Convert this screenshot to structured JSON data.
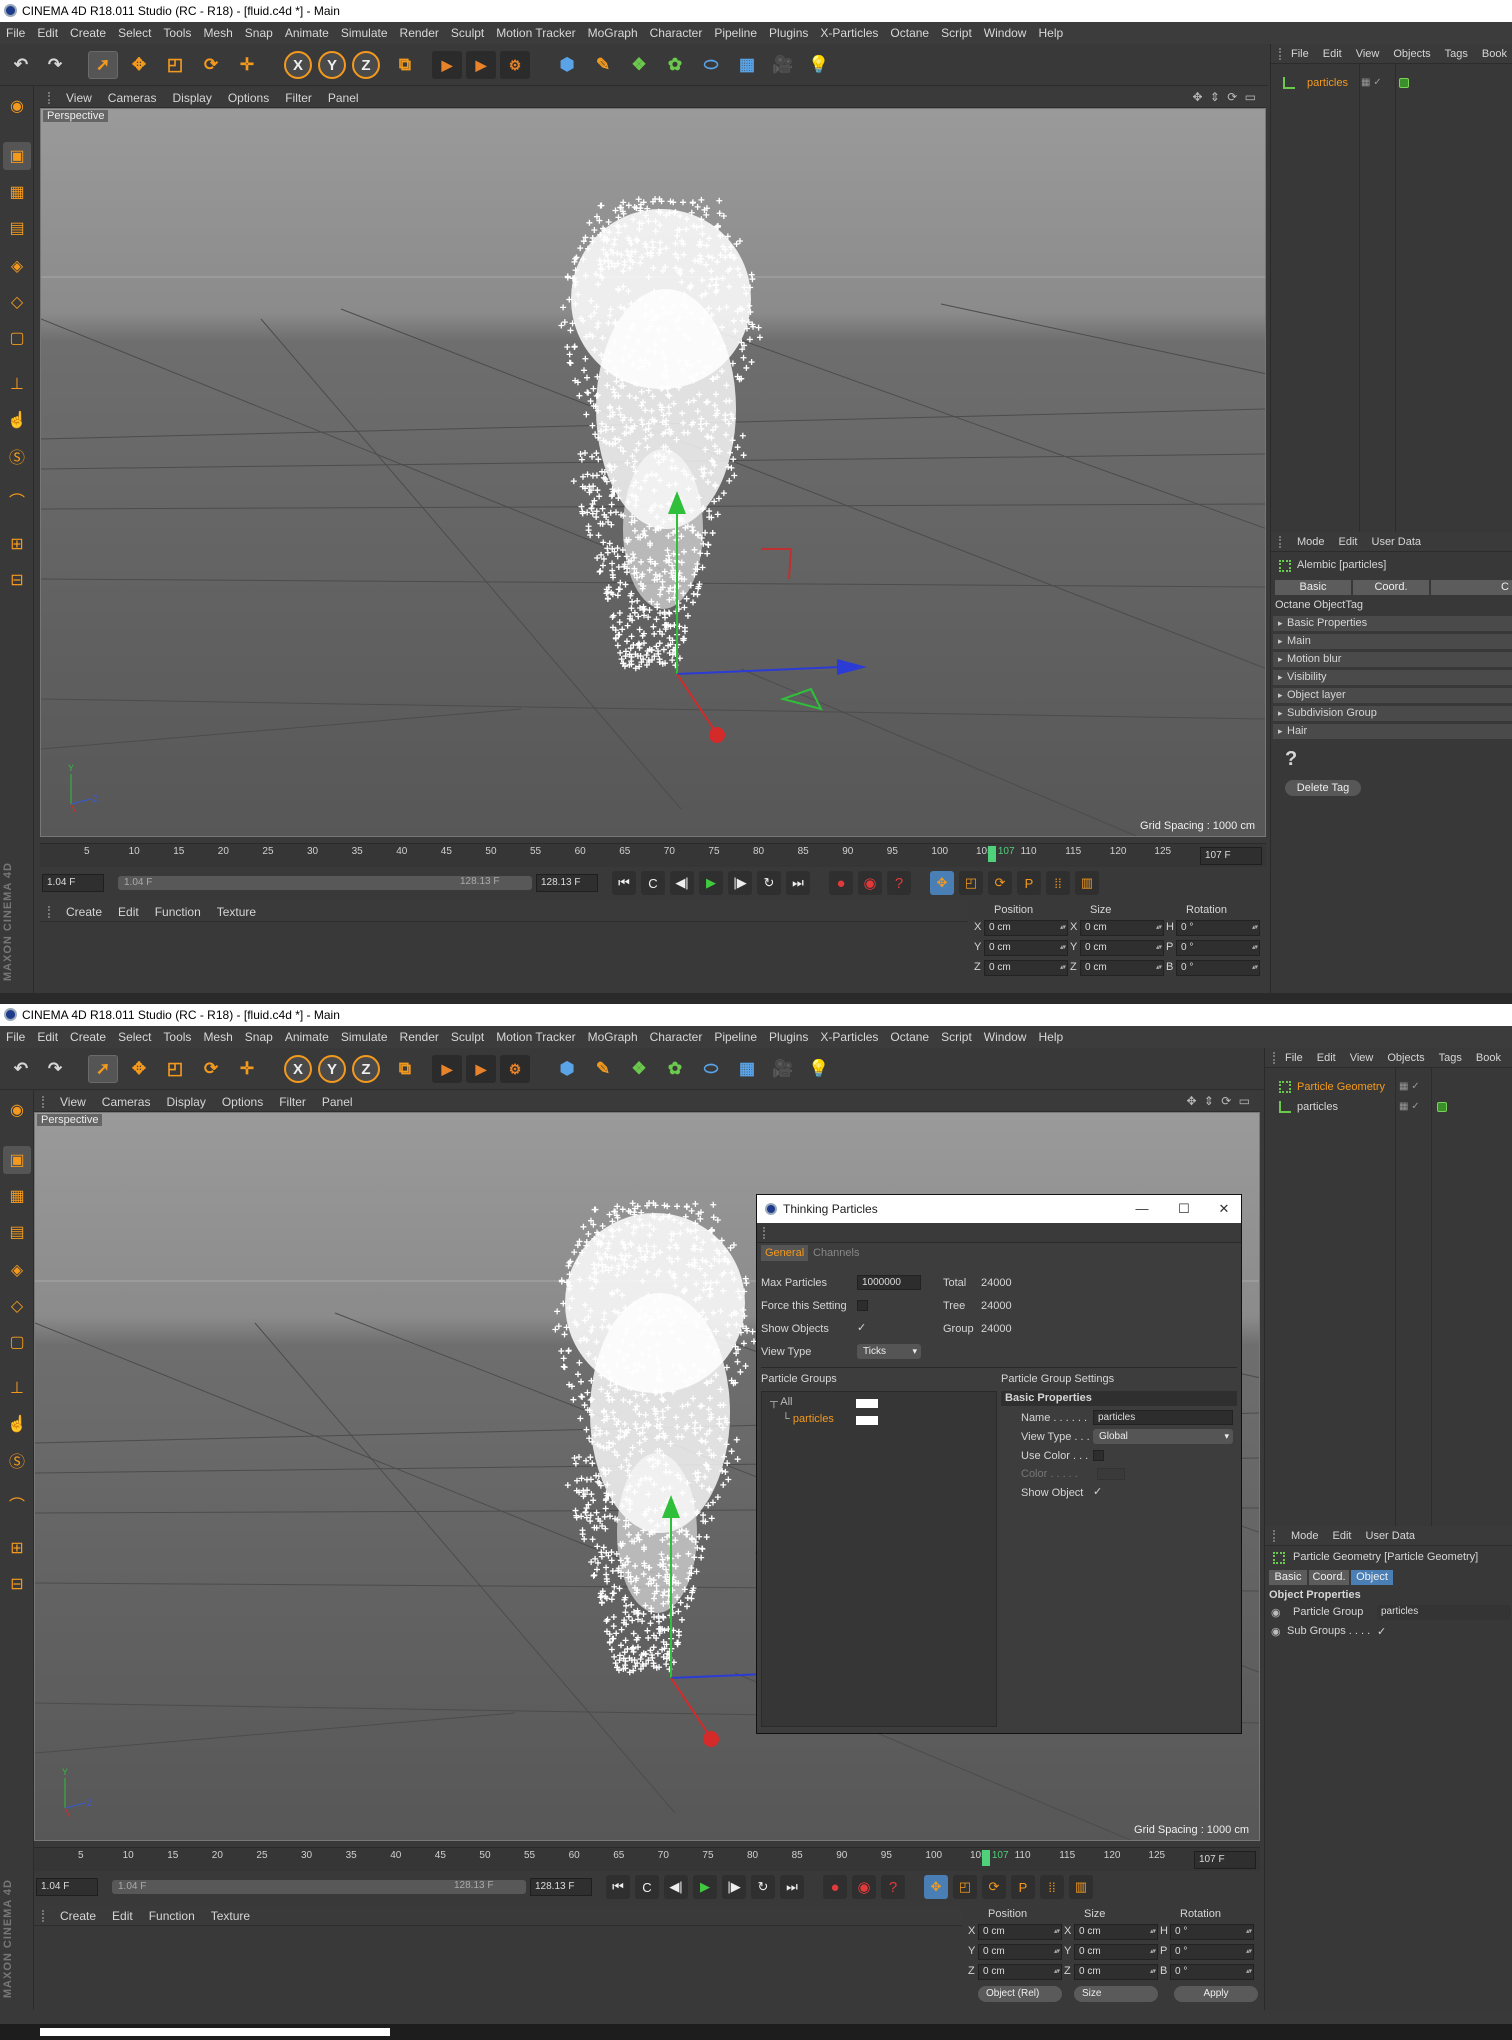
{
  "app": {
    "window_title": "CINEMA 4D R18.011 Studio (RC - R18) - [fluid.c4d *] - Main",
    "menu": [
      "File",
      "Edit",
      "Create",
      "Select",
      "Tools",
      "Mesh",
      "Snap",
      "Animate",
      "Simulate",
      "Render",
      "Sculpt",
      "Motion Tracker",
      "MoGraph",
      "Character",
      "Pipeline",
      "Plugins",
      "X-Particles",
      "Octane",
      "Script",
      "Window",
      "Help"
    ],
    "axis_buttons": [
      "X",
      "Y",
      "Z"
    ],
    "branding": "MAXON CINEMA 4D"
  },
  "icons": {
    "toolbar": [
      "undo-icon",
      "redo-icon",
      "select-arrow-icon",
      "move-icon",
      "scale-icon",
      "rotate-icon",
      "live-selection-icon",
      "x-axis-icon",
      "y-axis-icon",
      "z-axis-icon",
      "coordinate-system-icon",
      "render-view-icon",
      "render-picture-viewer-icon",
      "render-settings-icon",
      "cube-icon",
      "pen-icon",
      "subdivision-icon",
      "cloner-icon",
      "deformer-icon",
      "floor-icon",
      "camera-icon",
      "light-icon"
    ],
    "leftbar": [
      "make-editable-icon",
      "model-mode-icon",
      "texture-mode-icon",
      "workplane-icon",
      "points-mode-icon",
      "edges-mode-icon",
      "polygons-mode-icon",
      "axis-mode-icon",
      "tweak-mode-icon",
      "solo-icon",
      "snap-icon",
      "locked-workplane-icon",
      "planar-workplane-icon"
    ]
  },
  "viewport": {
    "menu": [
      "View",
      "Cameras",
      "Display",
      "Options",
      "Filter",
      "Panel"
    ],
    "label": "Perspective",
    "grid_spacing": "Grid Spacing : 1000 cm",
    "axis_labels": [
      "Y",
      "Z"
    ]
  },
  "timeline": {
    "ticks": [
      "5",
      "10",
      "15",
      "20",
      "25",
      "30",
      "35",
      "40",
      "45",
      "50",
      "55",
      "60",
      "65",
      "70",
      "75",
      "80",
      "85",
      "90",
      "95",
      "100",
      "105",
      "110",
      "115",
      "120",
      "125"
    ],
    "current_frame_marker": "107",
    "current_frame_field": "107 F",
    "start_field": "1.04 F",
    "range_start": "1.04 F",
    "range_end": "128.13 F",
    "end_field": "128.13 F"
  },
  "material_manager": {
    "menu": [
      "Create",
      "Edit",
      "Function",
      "Texture"
    ]
  },
  "coordinates": {
    "headers": [
      "Position",
      "Size",
      "Rotation"
    ],
    "rows": [
      {
        "axis": "X",
        "pos": "0 cm",
        "size_axis": "X",
        "size": "0 cm",
        "rot_axis": "H",
        "rot": "0 °"
      },
      {
        "axis": "Y",
        "pos": "0 cm",
        "size_axis": "Y",
        "size": "0 cm",
        "rot_axis": "P",
        "rot": "0 °"
      },
      {
        "axis": "Z",
        "pos": "0 cm",
        "size_axis": "Z",
        "size": "0 cm",
        "rot_axis": "B",
        "rot": "0 °"
      }
    ],
    "mode": "Object (Rel)",
    "size_mode": "Size",
    "apply": "Apply"
  },
  "object_manager": {
    "menu": [
      "File",
      "Edit",
      "View",
      "Objects",
      "Tags",
      "Book"
    ],
    "shot1_objects": [
      "particles"
    ],
    "shot2_objects": [
      "Particle Geometry",
      "particles"
    ]
  },
  "attributes": {
    "menu": [
      "Mode",
      "Edit",
      "User Data"
    ],
    "shot1": {
      "title": "Alembic [particles]",
      "tabs": [
        "Basic",
        "Coord.",
        "C"
      ],
      "section": "Octane ObjectTag",
      "groups": [
        "Basic Properties",
        "Main",
        "Motion blur",
        "Visibility",
        "Object layer",
        "Subdivision Group",
        "Hair"
      ],
      "help": "?",
      "delete_tag": "Delete Tag"
    },
    "shot2": {
      "title": "Particle Geometry [Particle Geometry]",
      "tabs": [
        "Basic",
        "Coord.",
        "Object"
      ],
      "section": "Object Properties",
      "particle_group_label": "Particle Group",
      "particle_group_value": "particles",
      "sub_groups_label": "Sub Groups . . . ."
    }
  },
  "thinking_particles": {
    "title": "Thinking Particles",
    "tabs": [
      "General",
      "Channels"
    ],
    "max_particles_label": "Max Particles",
    "max_particles_value": "1000000",
    "force_label": "Force this Setting",
    "show_objects_label": "Show Objects",
    "view_type_label": "View Type",
    "view_type_value": "Ticks",
    "stats": [
      {
        "label": "Total",
        "value": "24000"
      },
      {
        "label": "Tree",
        "value": "24000"
      },
      {
        "label": "Group",
        "value": "24000"
      }
    ],
    "groups_header": "Particle Groups",
    "groups": [
      "All",
      "particles"
    ],
    "settings_header": "Particle Group Settings",
    "basic_properties": "Basic Properties",
    "name_label": "Name . . . . . .",
    "name_value": "particles",
    "view_type2_label": "View Type . . .",
    "view_type2_value": "Global",
    "use_color_label": "Use Color . . .",
    "color_label": "Color . . . . .",
    "show_object_label": "Show Object"
  },
  "colors": {
    "accent": "#f39a1e",
    "playhead": "#4fd07a",
    "bg": "#393939"
  }
}
